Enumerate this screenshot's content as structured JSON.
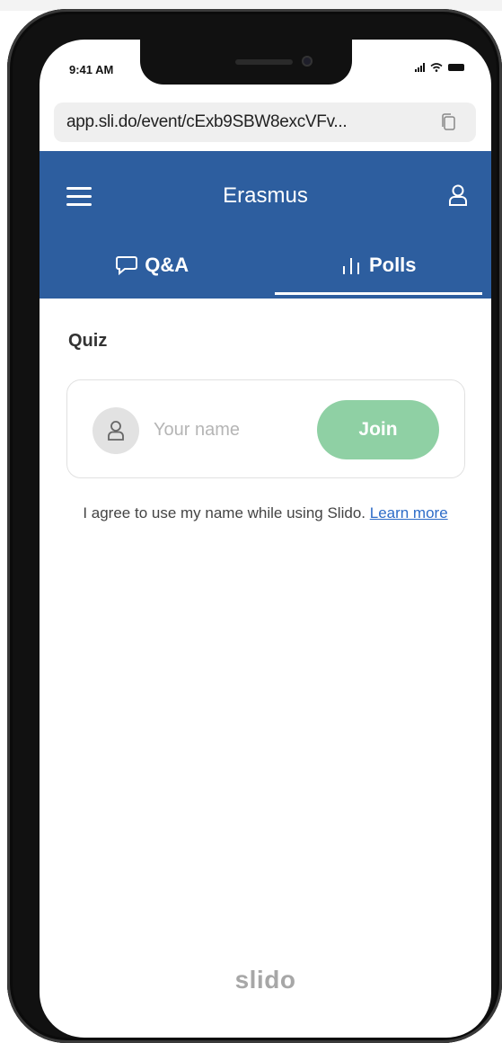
{
  "status_bar": {
    "time": "9:41 AM",
    "icons": [
      "signal-icon",
      "wifi-icon",
      "battery-icon"
    ]
  },
  "browser": {
    "url": "app.sli.do/event/cExb9SBW8excVFv...",
    "copy_icon": "copy-icon"
  },
  "header": {
    "title": "Erasmus",
    "menu_icon": "hamburger-menu-icon",
    "user_icon": "user-icon",
    "background_color": "#2d5e9f"
  },
  "tabs": [
    {
      "label": "Q&A",
      "icon": "chat-bubble-icon",
      "active": false
    },
    {
      "label": "Polls",
      "icon": "bar-chart-icon",
      "active": true
    }
  ],
  "quiz": {
    "title": "Quiz",
    "name_placeholder": "Your name",
    "name_value": "",
    "join_label": "Join",
    "join_color": "#8fd0a4"
  },
  "consent": {
    "text": "I agree to use my name while using Slido.",
    "link_text": "Learn more"
  },
  "footer": {
    "logo_text": "slido"
  }
}
